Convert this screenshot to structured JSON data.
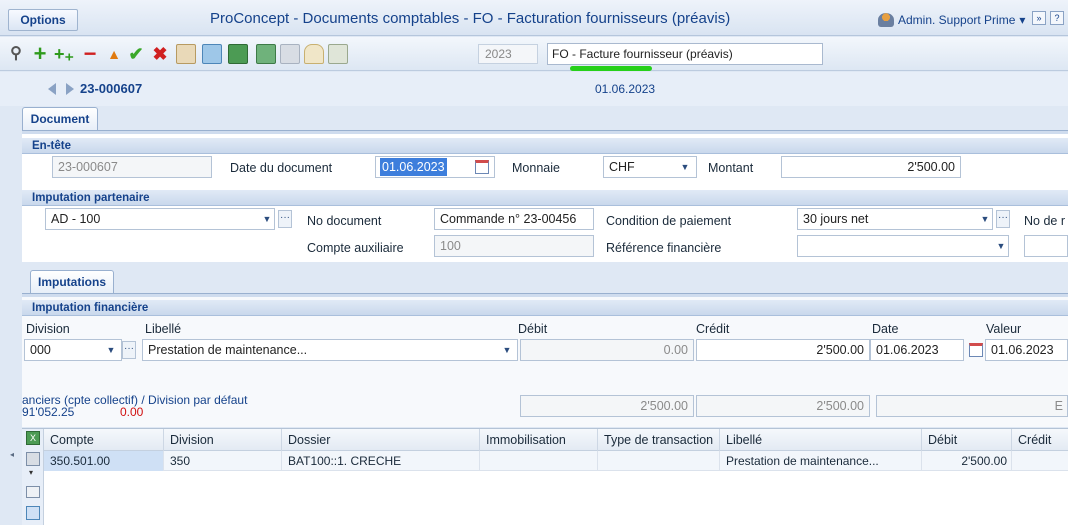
{
  "window": {
    "options_label": "Options",
    "title": "ProConcept - Documents comptables - FO - Facturation fournisseurs (préavis)",
    "user_label": "Admin. Support Prime",
    "user_caret": "▾"
  },
  "toolbar": {
    "year": "2023",
    "document_type": "FO - Facture fournisseur (préavis)"
  },
  "nav": {
    "document_number": "23-000607",
    "document_date": "01.06.2023"
  },
  "tabs": {
    "document": "Document",
    "imputations": "Imputations"
  },
  "header_section": {
    "title": "En-tête",
    "number_value": "23-000607",
    "date_label": "Date du document",
    "date_value": "01.06.2023",
    "currency_label": "Monnaie",
    "currency_value": "CHF",
    "amount_label": "Montant",
    "amount_value": "2'500.00"
  },
  "partner_section": {
    "title": "Imputation partenaire",
    "partner_value": "AD - 100",
    "doc_no_label": "No document",
    "doc_no_value": "Commande n° 23-00456",
    "payment_cond_label": "Condition de paiement",
    "payment_cond_value": "30 jours net",
    "no_ref_label": "No de r",
    "aux_account_label": "Compte auxiliaire",
    "aux_account_value": "100",
    "fin_ref_label": "Référence financière",
    "fin_ref_value": ""
  },
  "fin_section": {
    "title": "Imputation financière",
    "col_division": "Division",
    "col_libelle": "Libellé",
    "col_debit": "Débit",
    "col_credit": "Crédit",
    "col_date": "Date",
    "col_valeur": "Valeur",
    "division_value": "000",
    "libelle_value": "Prestation de maintenance...",
    "debit_value": "0.00",
    "credit_value": "2'500.00",
    "date_value": "01.06.2023",
    "valeur_value": "01.06.2023",
    "note_line1": "anciers (cpte collectif) / Division par défaut",
    "note_value1": "91'052.25",
    "note_value2": "0.00",
    "total_debit": "2'500.00",
    "total_credit": "2'500.00",
    "right_btn": "E"
  },
  "grid": {
    "headers": [
      "Compte",
      "Division",
      "Dossier",
      "Immobilisation",
      "Type de transaction",
      "Libellé",
      "Débit",
      "Crédit"
    ],
    "rows": [
      [
        "350.501.00",
        "350",
        "BAT100::1. CRECHE",
        "",
        "",
        "Prestation de maintenance...",
        "2'500.00",
        ""
      ]
    ]
  },
  "colors": {
    "accent": "#15428b",
    "selection": "#3d7edc",
    "negative": "#d01010",
    "highlight_mark": "#27d01a"
  }
}
